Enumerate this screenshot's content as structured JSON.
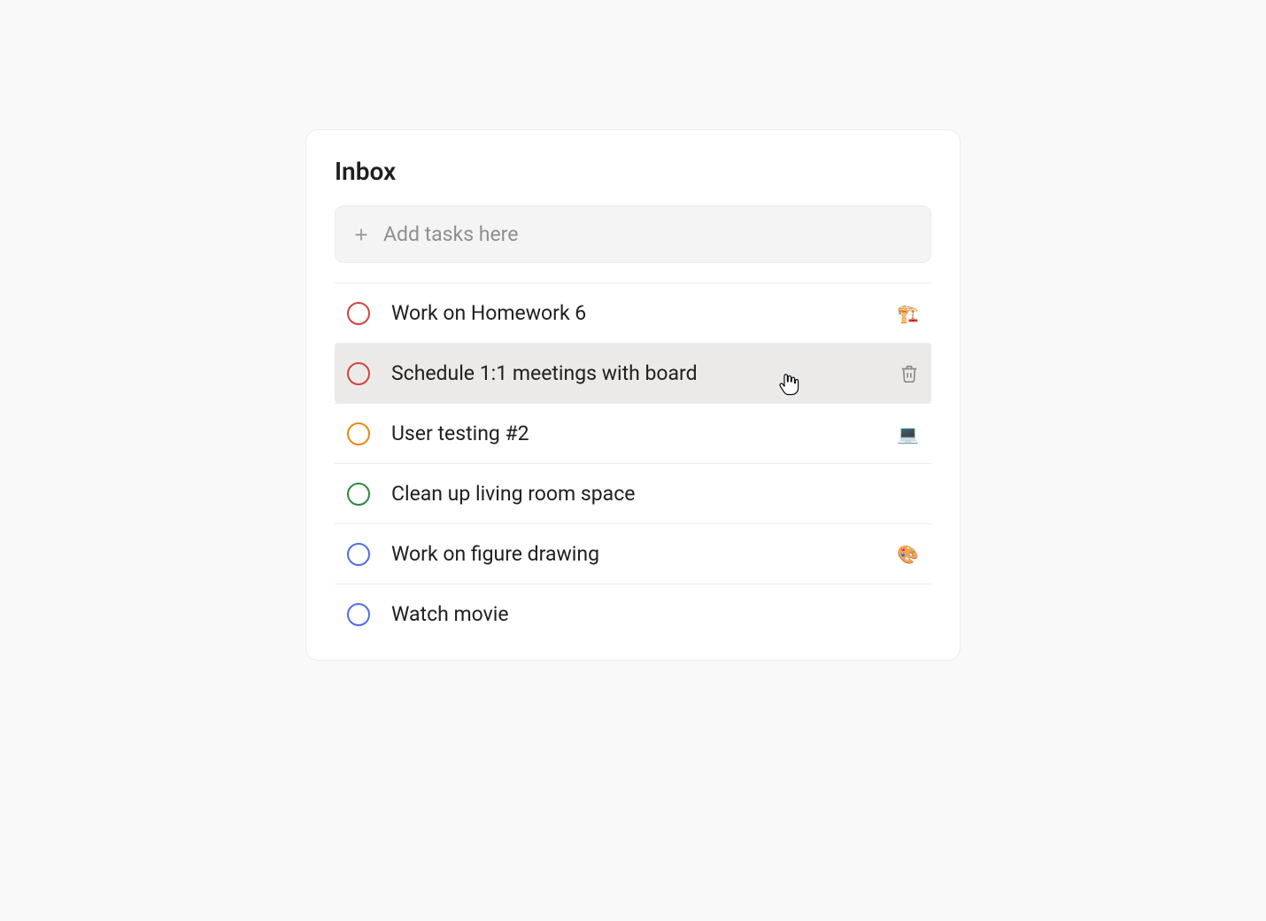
{
  "header": {
    "title": "Inbox"
  },
  "add": {
    "placeholder": "Add tasks here"
  },
  "priorityColors": {
    "red": "priority-red",
    "orange": "priority-orange",
    "green": "priority-green",
    "blue": "priority-blue"
  },
  "tasks": [
    {
      "label": "Work on Homework 6",
      "priority": "red",
      "tag": "🏗️",
      "hovered": false
    },
    {
      "label": "Schedule 1:1 meetings with board",
      "priority": "red",
      "tag": "",
      "hovered": true
    },
    {
      "label": "User testing #2",
      "priority": "orange",
      "tag": "💻",
      "hovered": false
    },
    {
      "label": "Clean up living room space",
      "priority": "green",
      "tag": "",
      "hovered": false
    },
    {
      "label": "Work on figure drawing",
      "priority": "blue",
      "tag": "🎨",
      "hovered": false
    },
    {
      "label": "Watch movie",
      "priority": "blue",
      "tag": "",
      "hovered": false
    }
  ]
}
